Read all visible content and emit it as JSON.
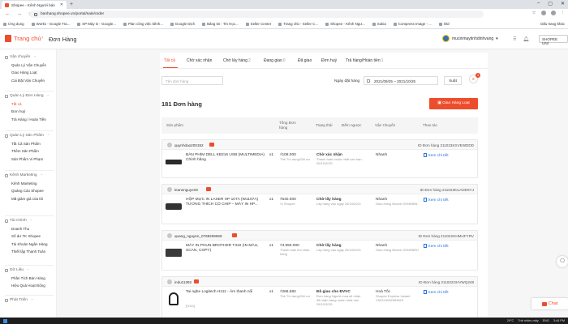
{
  "browser": {
    "tab_title": "Shopee - Kênh Người bán",
    "url": "banhang.shopee.vn/portal/sale/order",
    "bookmarks": [
      "Ứng dụng",
      "Works - Google Tra...",
      "SP Máy in - Google...",
      "Plan công việc kênh...",
      "Google Dịch",
      "Bảng tin - Tin Học...",
      "Seller Center",
      "Trang chủ - Seller C...",
      "Shopee - Kênh Ngư...",
      "Sukia",
      "Compress Image - ...",
      "Old"
    ],
    "bookmarks_right": "Dấu trang khác"
  },
  "topbar": {
    "logo_text": "Trang chủ",
    "breadcrumb_sep": "›",
    "page_title": "Đơn Hàng",
    "username": "mucinmaytinhdinhvang",
    "shopee_uni": "SHOPEE UNI"
  },
  "sidebar": {
    "sections": [
      {
        "title": "Vận chuyển",
        "items": [
          "Quản Lý Vận Chuyển",
          "Giao Hàng Loạt",
          "Cài Đặt Vận Chuyển"
        ]
      },
      {
        "title": "Quản Lý Đơn Hàng",
        "items": [
          "Tất cả",
          "Đơn huỷ",
          "Trả Hàng / Hoàn Tiền"
        ]
      },
      {
        "title": "Quản Lý Sản Phẩm",
        "items": [
          "Tất Cả Sản Phẩm",
          "Thêm Sản Phẩm",
          "Sản Phẩm Vi Phạm"
        ]
      },
      {
        "title": "Kênh Marketing",
        "items": [
          "Kênh Marketing",
          "Quảng Cáo Shopee",
          "Mã giảm giá của tôi"
        ]
      },
      {
        "title": "Tài Chính",
        "items": [
          "Doanh Thu",
          "Số dư TK Shopee",
          "Tài Khoản Ngân Hàng",
          "Thiết lập Thanh Toán"
        ]
      },
      {
        "title": "Dữ Liệu",
        "items": [
          "Phân Tích Bán Hàng",
          "Hiệu Quả Hoạt Động"
        ]
      },
      {
        "title": "Phát Triển",
        "items": []
      }
    ]
  },
  "tabs": [
    {
      "label": "Tất cả",
      "count": ""
    },
    {
      "label": "Chờ xác nhận",
      "count": ""
    },
    {
      "label": "Chờ lấy hàng",
      "count": "2"
    },
    {
      "label": "Đang giao",
      "count": "0"
    },
    {
      "label": "Đã giao",
      "count": ""
    },
    {
      "label": "Đơn huỷ",
      "count": ""
    },
    {
      "label": "Trả hàng/Hoàn tiền",
      "count": "1"
    }
  ],
  "filters": {
    "search_placeholder": "Tên đơn hàng",
    "date_label": "Ngày đặt hàng",
    "date_range": "2021/09/25 – 2021/10/25",
    "export_label": "Xuất",
    "badge_count": "1"
  },
  "order_count_label": "181 Đơn hàng",
  "bulk_ship_label": "Giao Hàng Loạt",
  "table_headers": [
    "Sản phẩm",
    "Tổng Đơn hàng",
    "Trạng thái",
    "Đếm ngược",
    "Vận Chuyển",
    "Thao tác"
  ],
  "orders": [
    {
      "user": "quynhdao200192",
      "order_id": "ID Đơn hàng 211023KXVEWDDD",
      "product": "BÀN PHÍM DELL KB216 USB (MULTIMEDIA) Chính hãng",
      "qty": "x1",
      "total": "₫108.000",
      "payment": "Thẻ Tín dụng/Ghi nợ",
      "status": "Chờ xác nhận",
      "status_note": "Thanh toán muộn nhất vào hạn 26/10/2021",
      "shipping": "Nhanh",
      "shipping_note": "",
      "action": "Xem chi tiết"
    },
    {
      "user": "leanonguyen9",
      "order_id": "ID Đơn hàng 211023KUADD6YJ",
      "product": "HỘP MỰC IN LASER HP 107A (W1107A) TƯƠNG THÍCH CÓ CHIP – MÁY IN HP...",
      "qty": "x1",
      "total": "₫540.000",
      "payment": "Ví Shopee",
      "status": "Chờ lấy hàng",
      "status_note": "Lấy hàng vào ngày 25/10/2021",
      "shipping": "Nhanh",
      "shipping_note": "Giao Hàng Nhanh GHNR8NL",
      "action": "Xem chi tiết"
    },
    {
      "user": "quang_nguyen_0768259568",
      "order_id": "ID Đơn hàng 211022HHMUFYRV",
      "product": "MÁY IN PHUN BROTHER T310 (IN MÀU, SCAN, COPY)",
      "qty": "x1",
      "total": "₫3.650.000",
      "payment": "Thanh toán khi nhận hàng",
      "status": "Chờ lấy hàng",
      "status_note": "Lấy hàng vào ngày 25/10/2021",
      "shipping": "Nhanh",
      "shipping_note": "Giao Hàng Nhanh GHNR8RU",
      "action": "Xem chi tiết"
    },
    {
      "user": "indu11392",
      "order_id": "ID Đơn hàng 211022GHVWQ248",
      "product": "Tai nghe Logitech H111 - Âm thanh nổi",
      "product_sub": "[H111]",
      "qty": "x1",
      "total": "₫266.582",
      "payment": "Thẻ Tín dụng/Ghi nợ",
      "status": "Đã giao cho ĐVVC",
      "status_note": "Đơn hàng Người mua sẽ nhận đã nhận hàng muộn nhất vào 26/10/2021",
      "shipping": "Hoả Tốc",
      "shipping_note": "Shopee Express Instant VN2110082063815",
      "action": "Xem chi tiết"
    }
  ],
  "chat_label": "Chat",
  "taskbar": {
    "temp": "29°C",
    "weather": "Trời nhiều mây",
    "lang": "ENG",
    "time": "3:44 PM"
  }
}
